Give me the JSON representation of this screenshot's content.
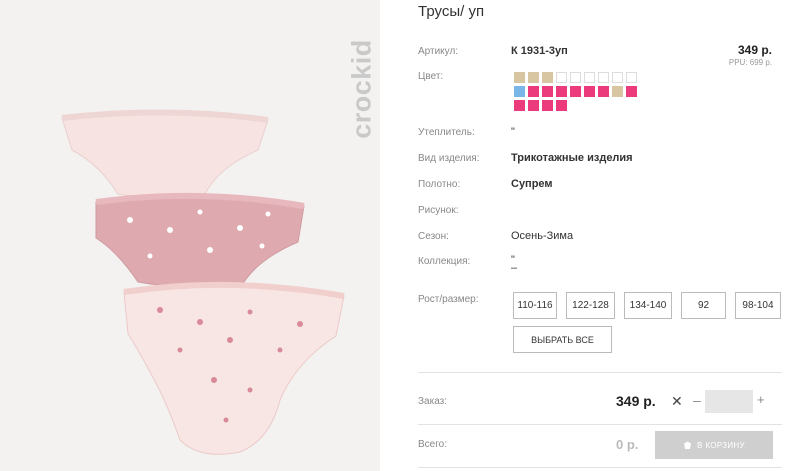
{
  "product": {
    "title": "Трусы/ уп",
    "brand": "crockid"
  },
  "labels": {
    "article": "Артикул:",
    "color": "Цвет:",
    "insulation": "Утеплитель:",
    "type": "Вид изделия:",
    "fabric": "Полотно:",
    "pattern": "Рисунок:",
    "season": "Сезон:",
    "collection": "Коллекция:",
    "size": "Рост/размер:",
    "order": "Заказ:",
    "total": "Всего:"
  },
  "values": {
    "article": "К 1931-3уп",
    "insulation": "\"",
    "type": "Трикотажные изделия",
    "fabric": "Супрем",
    "pattern": "",
    "season": "Осень-Зима",
    "collection_line1": "\"",
    "collection_line2": "–"
  },
  "pricing": {
    "price": "349 р.",
    "ppu": "PPU: 699 р.",
    "order_price": "349 р.",
    "times": "✕",
    "minus": "–",
    "plus": "+",
    "quantity": "",
    "total": "0 р."
  },
  "swatches": [
    [
      "#d8c6a3",
      "#d8c6a3",
      "#d8c6a3",
      "#ffffff",
      "#ffffff",
      "#ffffff",
      "#ffffff",
      "#ffffff",
      "#ffffff"
    ],
    [
      "#7ab6e8",
      "#ec3b7d",
      "#ec3b7d",
      "#ec3b7d",
      "#ec3b7d",
      "#ec3b7d",
      "#ec3b7d",
      "#d8c6a3",
      "#ec3b7d"
    ],
    [
      "#ec3b7d",
      "#ec3b7d",
      "#ec3b7d",
      "#ec3b7d"
    ]
  ],
  "sizes": [
    "110-116",
    "122-128",
    "134-140",
    "92",
    "98-104"
  ],
  "buttons": {
    "select_all": "ВЫБРАТЬ ВСЕ",
    "add_to_cart": "В КОРЗИНУ"
  }
}
